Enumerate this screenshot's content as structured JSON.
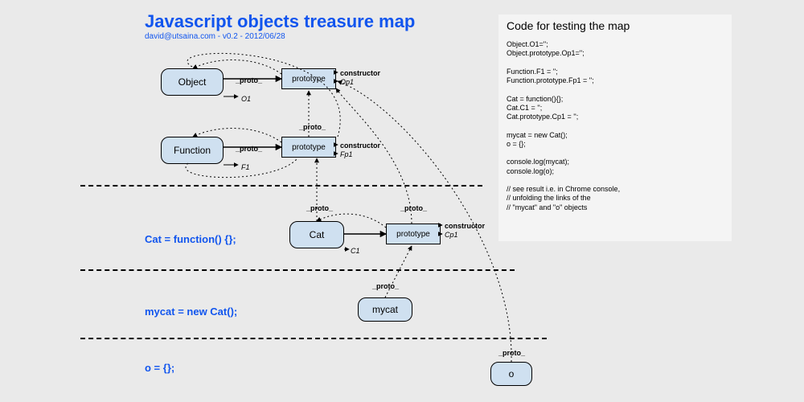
{
  "header": {
    "title": "Javascript objects treasure map",
    "subtitle": "david@utsaina.com - v0.2 - 2012/06/28"
  },
  "code_panel": {
    "heading": "Code for testing the map",
    "code": "Object.O1='';\nObject.prototype.Op1='';\n\nFunction.F1 = '';\nFunction.prototype.Fp1 = '';\n\nCat = function(){};\nCat.C1 = '';\nCat.prototype.Cp1 = '';\n\nmycat = new Cat();\no = {};\n\nconsole.log(mycat);\nconsole.log(o);\n\n// see result i.e. in Chrome console,\n// unfolding the links of the\n// \"mycat\" and \"o\" objects"
  },
  "nodes": {
    "object": "Object",
    "object_proto": "prototype",
    "function": "Function",
    "function_proto": "prototype",
    "cat": "Cat",
    "cat_proto": "prototype",
    "mycat": "mycat",
    "o": "o"
  },
  "defs": {
    "cat": "Cat = function() {};",
    "mycat": "mycat = new Cat();",
    "o": "o = {};"
  },
  "labels": {
    "proto": "_proto_",
    "constructor": "constructor",
    "op1": "Op1",
    "o1": "O1",
    "fp1": "Fp1",
    "f1": "F1",
    "cp1": "Cp1",
    "c1": "C1"
  }
}
